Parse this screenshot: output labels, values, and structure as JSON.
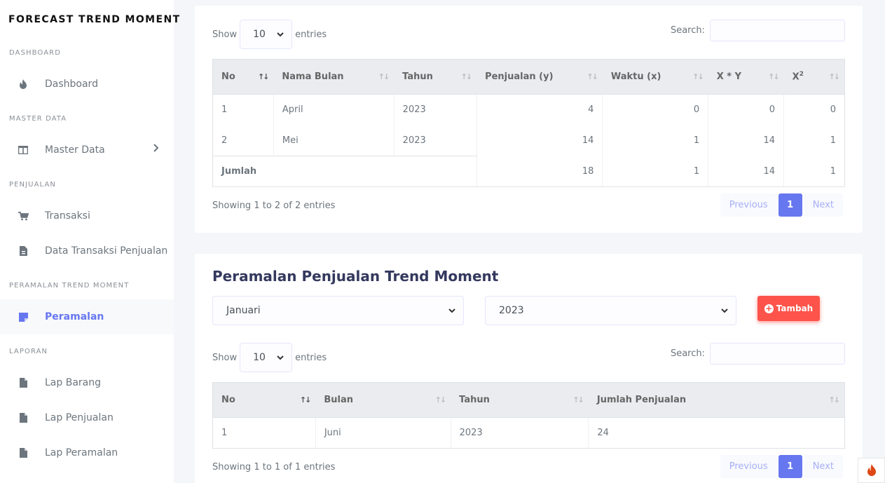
{
  "sidebar": {
    "brand": "FORECAST TREND MOMENT",
    "sections": {
      "dashboard": "DASHBOARD",
      "master": "MASTER DATA",
      "penjualan": "PENJUALAN",
      "peramalan": "PERAMALAN TREND MOMENT",
      "laporan": "LAPORAN"
    },
    "items": {
      "dashboard": "Dashboard",
      "master_data": "Master Data",
      "transaksi": "Transaksi",
      "data_transaksi": "Data Transaksi Penjualan",
      "peramalan": "Peramalan",
      "lap_barang": "Lap Barang",
      "lap_penjualan": "Lap Penjualan",
      "lap_peramalan": "Lap Peramalan"
    },
    "accent": "#6777ef"
  },
  "table1": {
    "show_label": "Show",
    "entries_value": "10",
    "entries_label": "entries",
    "search_label": "Search:",
    "headers": [
      "No",
      "Nama Bulan",
      "Tahun",
      "Penjualan (y)",
      "Waktu (x)",
      "X * Y",
      "X"
    ],
    "header_sup": "2",
    "rows": [
      {
        "no": "1",
        "bulan": "April",
        "tahun": "2023",
        "y": "4",
        "x": "0",
        "xy": "0",
        "x2": "0"
      },
      {
        "no": "2",
        "bulan": "Mei",
        "tahun": "2023",
        "y": "14",
        "x": "1",
        "xy": "14",
        "x2": "1"
      }
    ],
    "total": {
      "label": "Jumlah",
      "y": "18",
      "x": "1",
      "xy": "14",
      "x2": "1"
    },
    "info": "Showing 1 to 2 of 2 entries",
    "previous": "Previous",
    "page": "1",
    "next": "Next"
  },
  "forecast": {
    "title": "Peramalan Penjualan Trend Moment",
    "month_selected": "Januari",
    "year_selected": "2023",
    "add_button": "Tambah",
    "add_color": "#fc544b"
  },
  "table2": {
    "show_label": "Show",
    "entries_value": "10",
    "entries_label": "entries",
    "search_label": "Search:",
    "headers": [
      "No",
      "Bulan",
      "Tahun",
      "Jumlah Penjualan"
    ],
    "rows": [
      {
        "no": "1",
        "bulan": "Juni",
        "tahun": "2023",
        "jumlah": "24"
      }
    ],
    "info": "Showing 1 to 1 of 1 entries",
    "previous": "Previous",
    "page": "1",
    "next": "Next"
  }
}
